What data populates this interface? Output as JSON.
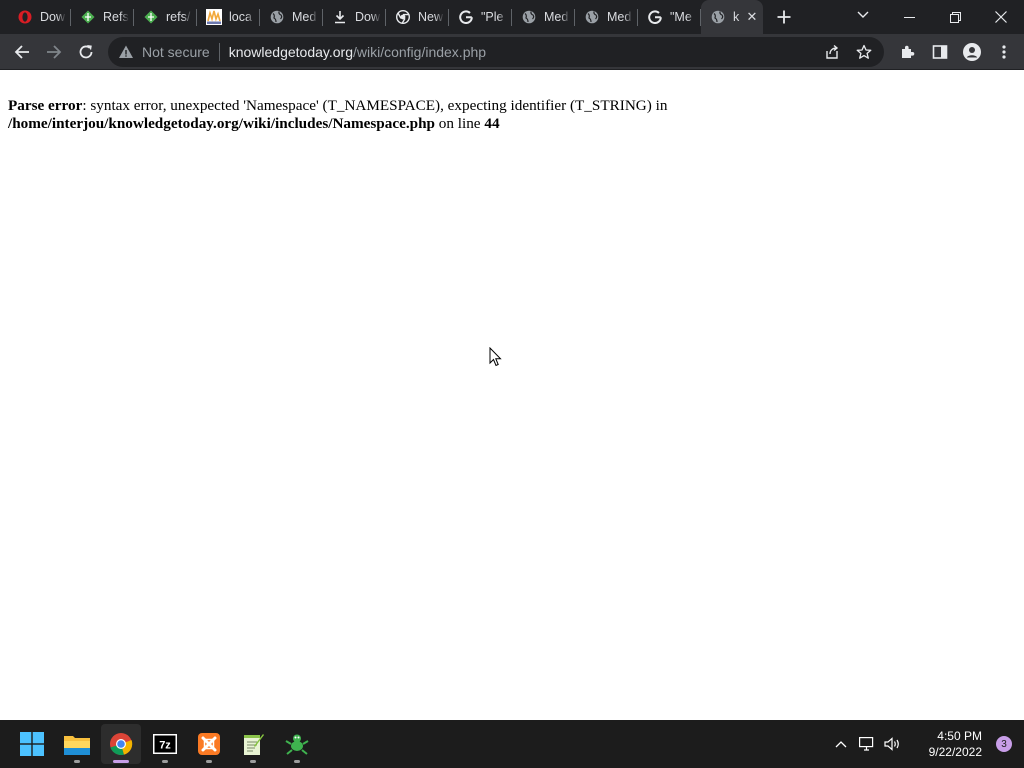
{
  "tabs": [
    {
      "title": "Dow",
      "icon": "opera-icon",
      "color": "#d81d24"
    },
    {
      "title": "Refs",
      "icon": "gitea-icon",
      "color": "#4caf50"
    },
    {
      "title": "refs/",
      "icon": "gitea-icon",
      "color": "#4caf50"
    },
    {
      "title": "loca",
      "icon": "phpmyadmin-icon",
      "color": "#f2a93b"
    },
    {
      "title": "Med",
      "icon": "globe-icon",
      "color": "#9aa0a6"
    },
    {
      "title": "Dow",
      "icon": "download-icon",
      "color": "#e8eaed"
    },
    {
      "title": "New",
      "icon": "chrome-icon",
      "color": "#e8eaed"
    },
    {
      "title": "\"Ple",
      "icon": "google-icon",
      "color": "#e8eaed"
    },
    {
      "title": "Med",
      "icon": "globe-icon",
      "color": "#9aa0a6"
    },
    {
      "title": "Med",
      "icon": "globe-icon",
      "color": "#9aa0a6"
    },
    {
      "title": "\"Me",
      "icon": "google-icon",
      "color": "#e8eaed"
    }
  ],
  "active_tab": {
    "title": "k",
    "icon": "globe-icon"
  },
  "toolbar": {
    "security_label": "Not secure",
    "url_host": "knowledgetoday.org",
    "url_path": "/wiki/config/index.php"
  },
  "page": {
    "error_label": "Parse error",
    "error_message": ": syntax error, unexpected 'Namespace' (T_NAMESPACE), expecting identifier (T_STRING) in",
    "error_file": "/home/interjou/knowledgetoday.org/wiki/includes/Namespace.php",
    "on_line_text": " on line ",
    "line_number": "44"
  },
  "taskbar": {
    "apps": [
      {
        "name": "file-explorer"
      },
      {
        "name": "chrome",
        "active": true
      },
      {
        "name": "7zip"
      },
      {
        "name": "xampp"
      },
      {
        "name": "notepad-plus-plus"
      },
      {
        "name": "gecko-app"
      }
    ],
    "time": "4:50 PM",
    "date": "9/22/2022",
    "notification_count": "3"
  },
  "colors": {
    "tabstrip_bg": "#202124",
    "toolbar_bg": "#35363a",
    "taskbar_bg": "#1c1c1c",
    "accent": "#c89ee8"
  }
}
